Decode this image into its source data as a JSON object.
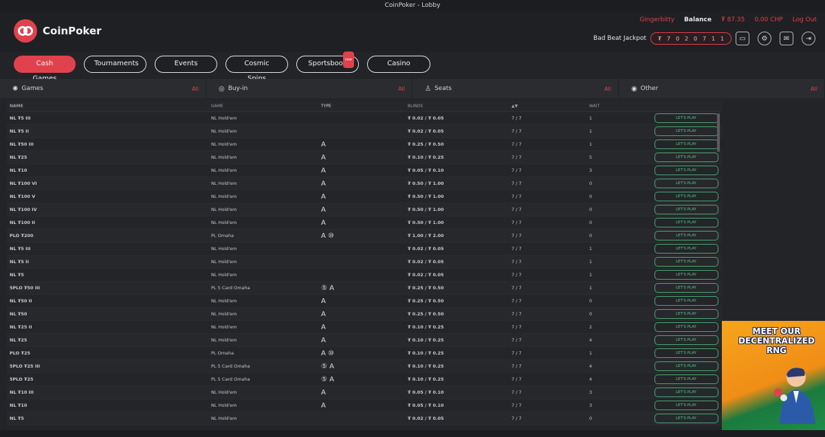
{
  "window": {
    "title": "CoinPoker - Lobby"
  },
  "brand": {
    "name": "CoinPoker",
    "accent": "#e0424d",
    "play_color": "#4aa874"
  },
  "account": {
    "username": "Gingerbitty",
    "balance_label": "Balance",
    "balance_value": "₮ 87.35",
    "chp_value": "0.00 CHP",
    "logout_label": "Log Out"
  },
  "jackpot": {
    "label": "Bad Beat Jackpot",
    "digits": [
      "₮",
      "7",
      "0",
      "2",
      "0",
      "7",
      "1",
      "1"
    ]
  },
  "top_icons": [
    "wallet-icon",
    "gear-icon",
    "mail-icon",
    "exit-icon"
  ],
  "tabs": [
    {
      "label": "Cash Games",
      "active": true
    },
    {
      "label": "Tournaments"
    },
    {
      "label": "Events"
    },
    {
      "label": "Cosmic Spins"
    },
    {
      "label": "Sportsbook",
      "badge": "new"
    },
    {
      "label": "Casino"
    }
  ],
  "filters": [
    {
      "label": "Games",
      "icon": "spinner-icon",
      "value": "All"
    },
    {
      "label": "Buy-in",
      "icon": "coin-icon",
      "value": "All"
    },
    {
      "label": "Seats",
      "icon": "person-icon",
      "value": "All"
    },
    {
      "label": "Other",
      "icon": "eye-icon",
      "value": "All"
    }
  ],
  "table": {
    "headers": {
      "name": "Name",
      "game": "Game",
      "type": "Type",
      "blinds": "Blinds",
      "seats": "▲▼",
      "wait": "Wait"
    },
    "play_label": "LET'S PLAY",
    "rows": [
      {
        "name": "NL ₮5 III",
        "game": "NL Hold'em",
        "type": "",
        "blinds": "₮ 0.02 / ₮ 0.05",
        "seats": "7 / 7",
        "wait": "1"
      },
      {
        "name": "NL ₮5 II",
        "game": "NL Hold'em",
        "type": "",
        "blinds": "₮ 0.02 / ₮ 0.05",
        "seats": "7 / 7",
        "wait": "1"
      },
      {
        "name": "NL ₮50 III",
        "game": "NL Hold'em",
        "type": "A",
        "blinds": "₮ 0.25 / ₮ 0.50",
        "seats": "7 / 7",
        "wait": "1"
      },
      {
        "name": "NL ₮25",
        "game": "NL Hold'em",
        "type": "A",
        "blinds": "₮ 0.10 / ₮ 0.25",
        "seats": "7 / 7",
        "wait": "5"
      },
      {
        "name": "NL ₮10",
        "game": "NL Hold'em",
        "type": "A",
        "blinds": "₮ 0.05 / ₮ 0.10",
        "seats": "7 / 7",
        "wait": "3"
      },
      {
        "name": "NL ₮100 VI",
        "game": "NL Hold'em",
        "type": "A",
        "blinds": "₮ 0.50 / ₮ 1.00",
        "seats": "7 / 7",
        "wait": "0"
      },
      {
        "name": "NL ₮100 V",
        "game": "NL Hold'em",
        "type": "A",
        "blinds": "₮ 0.50 / ₮ 1.00",
        "seats": "7 / 7",
        "wait": "0"
      },
      {
        "name": "NL ₮100 IV",
        "game": "NL Hold'em",
        "type": "A",
        "blinds": "₮ 0.50 / ₮ 1.00",
        "seats": "7 / 7",
        "wait": "0"
      },
      {
        "name": "NL ₮100 II",
        "game": "NL Hold'em",
        "type": "A",
        "blinds": "₮ 0.50 / ₮ 1.00",
        "seats": "7 / 7",
        "wait": "0"
      },
      {
        "name": "PLO ₮200",
        "game": "PL Omaha",
        "type": "A ⑩",
        "blinds": "₮ 1.00 / ₮ 2.00",
        "seats": "7 / 7",
        "wait": "0"
      },
      {
        "name": "NL ₮5 III",
        "game": "NL Hold'em",
        "type": "",
        "blinds": "₮ 0.02 / ₮ 0.05",
        "seats": "7 / 7",
        "wait": "1"
      },
      {
        "name": "NL ₮5 II",
        "game": "NL Hold'em",
        "type": "",
        "blinds": "₮ 0.02 / ₮ 0.05",
        "seats": "7 / 7",
        "wait": "1"
      },
      {
        "name": "NL ₮5",
        "game": "NL Hold'em",
        "type": "",
        "blinds": "₮ 0.02 / ₮ 0.05",
        "seats": "7 / 7",
        "wait": "1"
      },
      {
        "name": "5PLO ₮50 III",
        "game": "PL 5 Card Omaha",
        "type": "⑤ A",
        "blinds": "₮ 0.25 / ₮ 0.50",
        "seats": "7 / 7",
        "wait": "1"
      },
      {
        "name": "NL ₮50 II",
        "game": "NL Hold'em",
        "type": "A",
        "blinds": "₮ 0.25 / ₮ 0.50",
        "seats": "7 / 7",
        "wait": "0"
      },
      {
        "name": "NL ₮50",
        "game": "NL Hold'em",
        "type": "A",
        "blinds": "₮ 0.25 / ₮ 0.50",
        "seats": "7 / 7",
        "wait": "0"
      },
      {
        "name": "NL ₮25 II",
        "game": "NL Hold'em",
        "type": "A",
        "blinds": "₮ 0.10 / ₮ 0.25",
        "seats": "7 / 7",
        "wait": "2"
      },
      {
        "name": "NL ₮25",
        "game": "NL Hold'em",
        "type": "A",
        "blinds": "₮ 0.10 / ₮ 0.25",
        "seats": "7 / 7",
        "wait": "4"
      },
      {
        "name": "PLO ₮25",
        "game": "PL Omaha",
        "type": "A ⑩",
        "blinds": "₮ 0.10 / ₮ 0.25",
        "seats": "7 / 7",
        "wait": "1"
      },
      {
        "name": "5PLO ₮25 III",
        "game": "PL 5 Card Omaha",
        "type": "⑤ A",
        "blinds": "₮ 0.10 / ₮ 0.25",
        "seats": "7 / 7",
        "wait": "4"
      },
      {
        "name": "5PLO ₮25",
        "game": "PL 5 Card Omaha",
        "type": "⑤ A",
        "blinds": "₮ 0.10 / ₮ 0.25",
        "seats": "7 / 7",
        "wait": "4"
      },
      {
        "name": "NL ₮10 III",
        "game": "NL Hold'em",
        "type": "A",
        "blinds": "₮ 0.05 / ₮ 0.10",
        "seats": "7 / 7",
        "wait": "3"
      },
      {
        "name": "NL ₮10",
        "game": "NL Hold'em",
        "type": "A",
        "blinds": "₮ 0.05 / ₮ 0.10",
        "seats": "7 / 7",
        "wait": "3"
      },
      {
        "name": "NL ₮5",
        "game": "NL Hold'em",
        "type": "",
        "blinds": "₮ 0.02 / ₮ 0.05",
        "seats": "7 / 7",
        "wait": "0"
      }
    ]
  },
  "ad": {
    "headline": "MEET OUR DECENTRALIZED RNG"
  }
}
